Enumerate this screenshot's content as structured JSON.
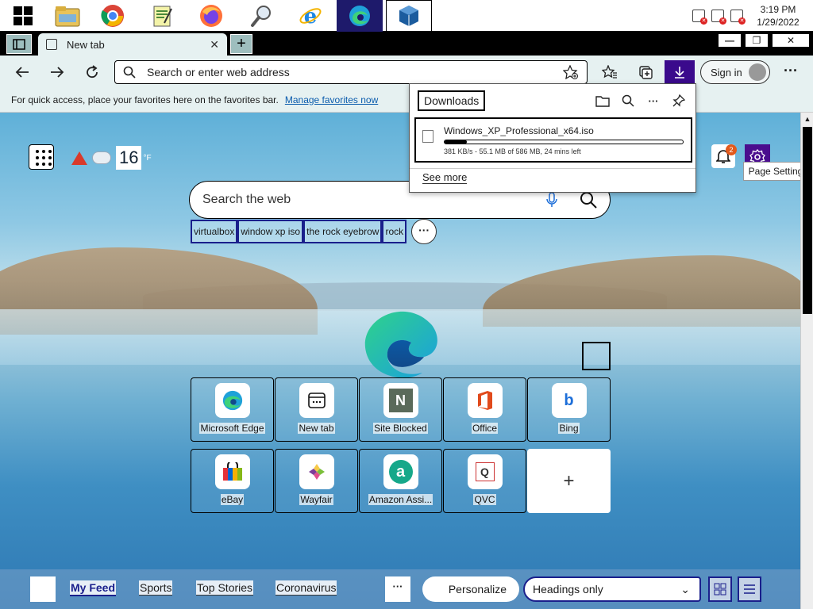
{
  "taskbar": {
    "apps": [
      {
        "name": "start",
        "icon": "windows-icon"
      },
      {
        "name": "file-explorer",
        "icon": "folder-icon"
      },
      {
        "name": "chrome",
        "icon": "chrome-icon"
      },
      {
        "name": "notepad",
        "icon": "notepad-icon"
      },
      {
        "name": "firefox",
        "icon": "firefox-icon"
      },
      {
        "name": "search",
        "icon": "magnifier-icon"
      },
      {
        "name": "internet-explorer",
        "icon": "ie-icon"
      },
      {
        "name": "edge",
        "icon": "edge-icon"
      },
      {
        "name": "virtualbox",
        "icon": "virtualbox-icon"
      }
    ],
    "time": "3:19 PM",
    "date": "1/29/2022"
  },
  "tabs": [
    {
      "title": "New tab"
    }
  ],
  "window_controls": {
    "minimize": "—",
    "restore": "❐",
    "close": "✕"
  },
  "toolbar": {
    "address_placeholder": "Search or enter web address",
    "sign_in": "Sign in",
    "more": "···"
  },
  "favorites_bar": {
    "message": "For quick access, place your favorites here on the favorites bar.",
    "link": "Manage favorites now"
  },
  "widgets": {
    "temperature": "16",
    "temp_unit": "°F",
    "notification_count": "2",
    "settings_tooltip": "Page Settings"
  },
  "search": {
    "placeholder": "Search the web",
    "suggestions": [
      "virtualbox",
      "window xp iso",
      "the rock eyebrow",
      "rock"
    ],
    "more": "···"
  },
  "quick_links": [
    {
      "label": "Microsoft Edge",
      "icon": "edge-icon"
    },
    {
      "label": "New tab",
      "icon": "newtab-icon"
    },
    {
      "label": "Site Blocked",
      "icon": "n-icon",
      "glyph": "N"
    },
    {
      "label": "Office",
      "icon": "office-icon"
    },
    {
      "label": "Bing",
      "icon": "bing-icon",
      "glyph": "b"
    },
    {
      "label": "eBay",
      "icon": "ebay-icon"
    },
    {
      "label": "Wayfair",
      "icon": "wayfair-icon"
    },
    {
      "label": "Amazon Assi...",
      "icon": "amazon-assistant-icon",
      "glyph": "a"
    },
    {
      "label": "QVC",
      "icon": "qvc-icon",
      "glyph": "Q"
    }
  ],
  "add_tile": "+",
  "feed": {
    "tabs": [
      "My Feed",
      "Sports",
      "Top Stories",
      "Coronavirus"
    ],
    "active_tab": "My Feed",
    "more": "···",
    "personalize": "Personalize",
    "layout_option": "Headings only"
  },
  "downloads": {
    "title": "Downloads",
    "file_name": "Windows_XP_Professional_x64.iso",
    "status": "381 KB/s - 55.1 MB of 586 MB, 24 mins left",
    "progress_fraction": 0.094,
    "see_more": "See more"
  },
  "colors": {
    "accent": "#3a0a8c",
    "focus_outline": "#1a1f8c",
    "badge": "#e35a1c"
  }
}
